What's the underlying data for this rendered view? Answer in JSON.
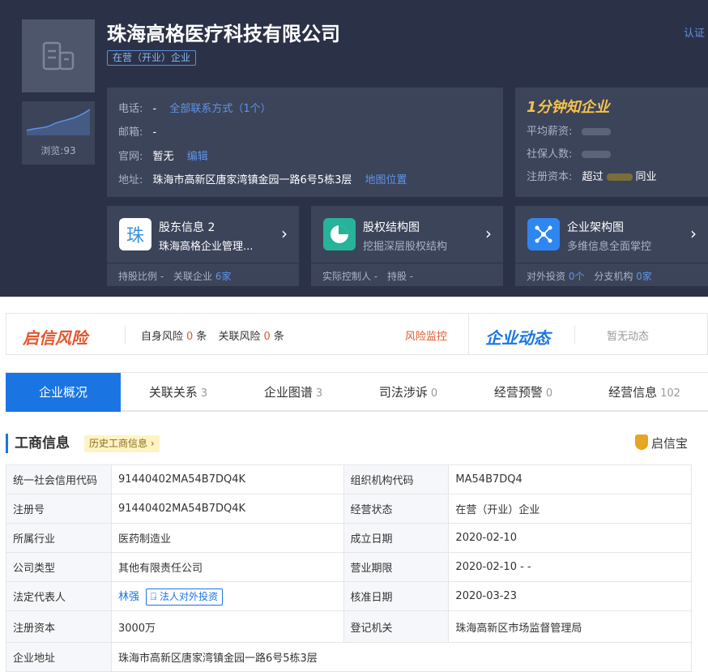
{
  "company": {
    "name": "珠海高格医疗科技有限公司",
    "status": "在营（开业）企业",
    "cert_link": "认证",
    "views": "浏览:93"
  },
  "contact": {
    "phone_label": "电话:",
    "phone_value": "-",
    "phone_link": "全部联系方式（1个）",
    "email_label": "邮箱:",
    "email_value": "-",
    "site_label": "官网:",
    "site_value": "暂无",
    "site_link": "编辑",
    "addr_label": "地址:",
    "addr_value": "珠海市高新区唐家湾镇金园一路6号5栋3层",
    "addr_link": "地图位置"
  },
  "quick": {
    "title": "1分钟知企业",
    "salary_label": "平均薪资:",
    "insured_label": "社保人数:",
    "capital_label": "注册资本:",
    "capital_prefix": "超过",
    "capital_suffix": "同业"
  },
  "cards": [
    {
      "icon_char": "珠",
      "title": "股东信息 2",
      "subtitle": "珠海高格企业管理...",
      "foot_a": "持股比例 -",
      "foot_b": "关联企业",
      "foot_b_val": "6家"
    },
    {
      "title": "股权结构图",
      "subtitle": "挖掘深层股权结构",
      "foot_a": "实际控制人 -",
      "foot_b": "持股 -",
      "foot_b_val": ""
    },
    {
      "title": "企业架构图",
      "subtitle": "多维信息全面掌控",
      "foot_a": "对外投资",
      "foot_a_val": "0个",
      "foot_b": "分支机构",
      "foot_b_val": "0家"
    }
  ],
  "risk": {
    "logo": "启信风险",
    "self_label": "自身风险",
    "self_count": "0",
    "rel_label": "关联风险",
    "rel_count": "0",
    "unit": "条",
    "monitor": "风险监控",
    "dyn_logo": "企业动态",
    "dyn_none": "暂无动态"
  },
  "tabs": [
    {
      "label": "企业概况",
      "count": ""
    },
    {
      "label": "关联关系",
      "count": "3"
    },
    {
      "label": "企业图谱",
      "count": "3"
    },
    {
      "label": "司法涉诉",
      "count": "0"
    },
    {
      "label": "经营预警",
      "count": "0"
    },
    {
      "label": "经营信息",
      "count": "102"
    }
  ],
  "section": {
    "title": "工商信息",
    "history": "历史工商信息 ›",
    "brand": "启信宝"
  },
  "info": {
    "credit_code_label": "统一社会信用代码",
    "credit_code": "91440402MA54B7DQ4K",
    "org_code_label": "组织机构代码",
    "org_code": "MA54B7DQ4",
    "reg_no_label": "注册号",
    "reg_no": "91440402MA54B7DQ4K",
    "status_label": "经营状态",
    "status": "在营（开业）企业",
    "industry_label": "所属行业",
    "industry": "医药制造业",
    "found_label": "成立日期",
    "found": "2020-02-10",
    "type_label": "公司类型",
    "type": "其他有限责任公司",
    "term_label": "营业期限",
    "term": "2020-02-10 - -",
    "rep_label": "法定代表人",
    "rep": "林强",
    "rep_btn": "法人对外投资",
    "approve_label": "核准日期",
    "approve": "2020-03-23",
    "capital_label": "注册资本",
    "capital": "3000万",
    "authority_label": "登记机关",
    "authority": "珠海高新区市场监督管理局",
    "address_label": "企业地址",
    "address": "珠海市高新区唐家湾镇金园一路6号5栋3层"
  }
}
